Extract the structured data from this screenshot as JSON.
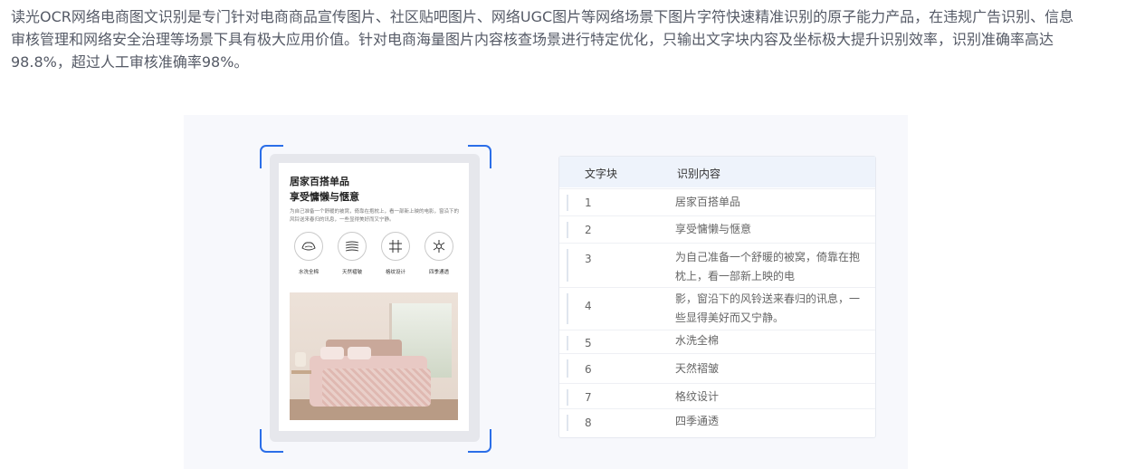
{
  "intro": "读光OCR网络电商图文识别是专门针对电商商品宣传图片、社区贴吧图片、网络UGC图片等网络场景下图片字符快速精准识别的原子能力产品，在违规广告识别、信息审核管理和网络安全治理等场景下具有极大应用价值。针对电商海量图片内容核查场景进行特定优化，只输出文字块内容及坐标极大提升识别效率，识别准确率高达98.8%，超过人工审核准确率98%。",
  "accent_color": "#2b6ee8",
  "product": {
    "title1": "居家百搭单品",
    "title2": "享受慵懒与惬意",
    "desc": "为自己准备一个舒暖的被窝，倚靠在抱枕上，看一部新上映的电影，窗沿下的风铃送来春归的讯息，一些显得美好而又宁静。",
    "features": [
      {
        "icon": "wash-icon",
        "label": "水洗全棉"
      },
      {
        "icon": "wrinkle-icon",
        "label": "天然褶皱"
      },
      {
        "icon": "grid-icon",
        "label": "格纹设计"
      },
      {
        "icon": "season-icon",
        "label": "四季通透"
      }
    ]
  },
  "result": {
    "col_block": "文字块",
    "col_content": "识别内容",
    "rows": [
      {
        "num": "1",
        "text": "居家百搭单品"
      },
      {
        "num": "2",
        "text": "享受慵懒与惬意"
      },
      {
        "num": "3",
        "text": "为自己准备一个舒暖的被窝，倚靠在抱枕上，看一部新上映的电"
      },
      {
        "num": "4",
        "text": "影，窗沿下的风铃送来春归的讯息，一些显得美好而又宁静。"
      },
      {
        "num": "5",
        "text": "水洗全棉"
      },
      {
        "num": "6",
        "text": "天然褶皱"
      },
      {
        "num": "7",
        "text": "格纹设计"
      },
      {
        "num": "8",
        "text": "四季通透"
      }
    ]
  }
}
